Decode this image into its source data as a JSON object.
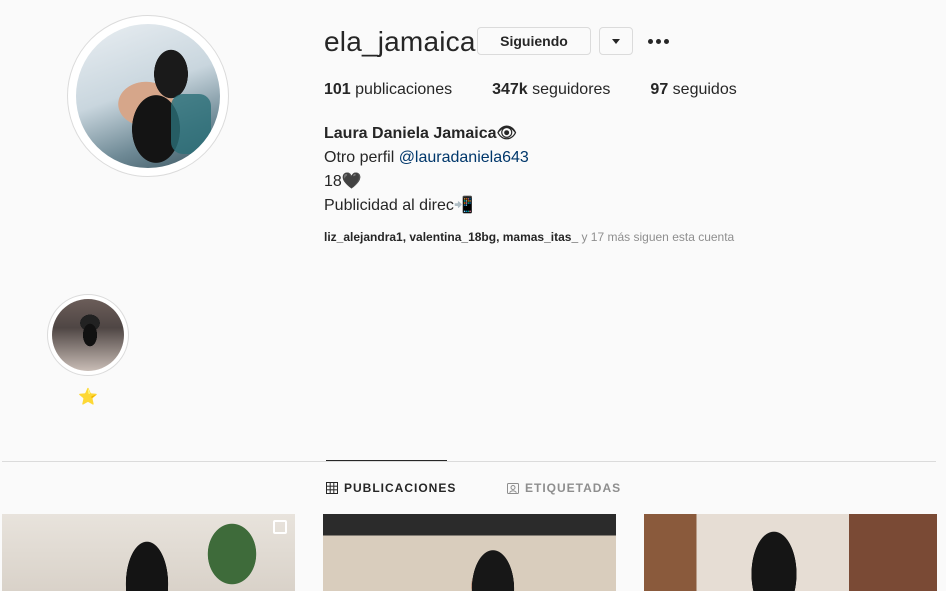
{
  "profile": {
    "username": "ela_jamaica",
    "follow_button": "Siguiendo",
    "stats": [
      {
        "count": "101",
        "label": " publicaciones"
      },
      {
        "count": "347k",
        "label": " seguidores"
      },
      {
        "count": "97",
        "label": " seguidos"
      }
    ],
    "bio": {
      "name": "Laura Daniela Jamaica👁",
      "line2_prefix": "Otro perfil ",
      "line2_link": "@lauradaniela643",
      "line3": "18🖤",
      "line4": "Publicidad al direc📲"
    },
    "followed_by": {
      "users": "liz_alejandra1, valentina_18bg, mamas_itas_",
      "suffix": " y 17 más siguen esta cuenta"
    }
  },
  "highlights": [
    {
      "label": "⭐"
    }
  ],
  "tabs": {
    "posts": "PUBLICACIONES",
    "tagged": "ETIQUETADAS"
  },
  "icons": {
    "more": "more-options-icon",
    "dropdown": "chevron-down-icon",
    "grid": "grid-icon",
    "tag": "tag-icon",
    "multi": "multiple-photos-icon"
  }
}
